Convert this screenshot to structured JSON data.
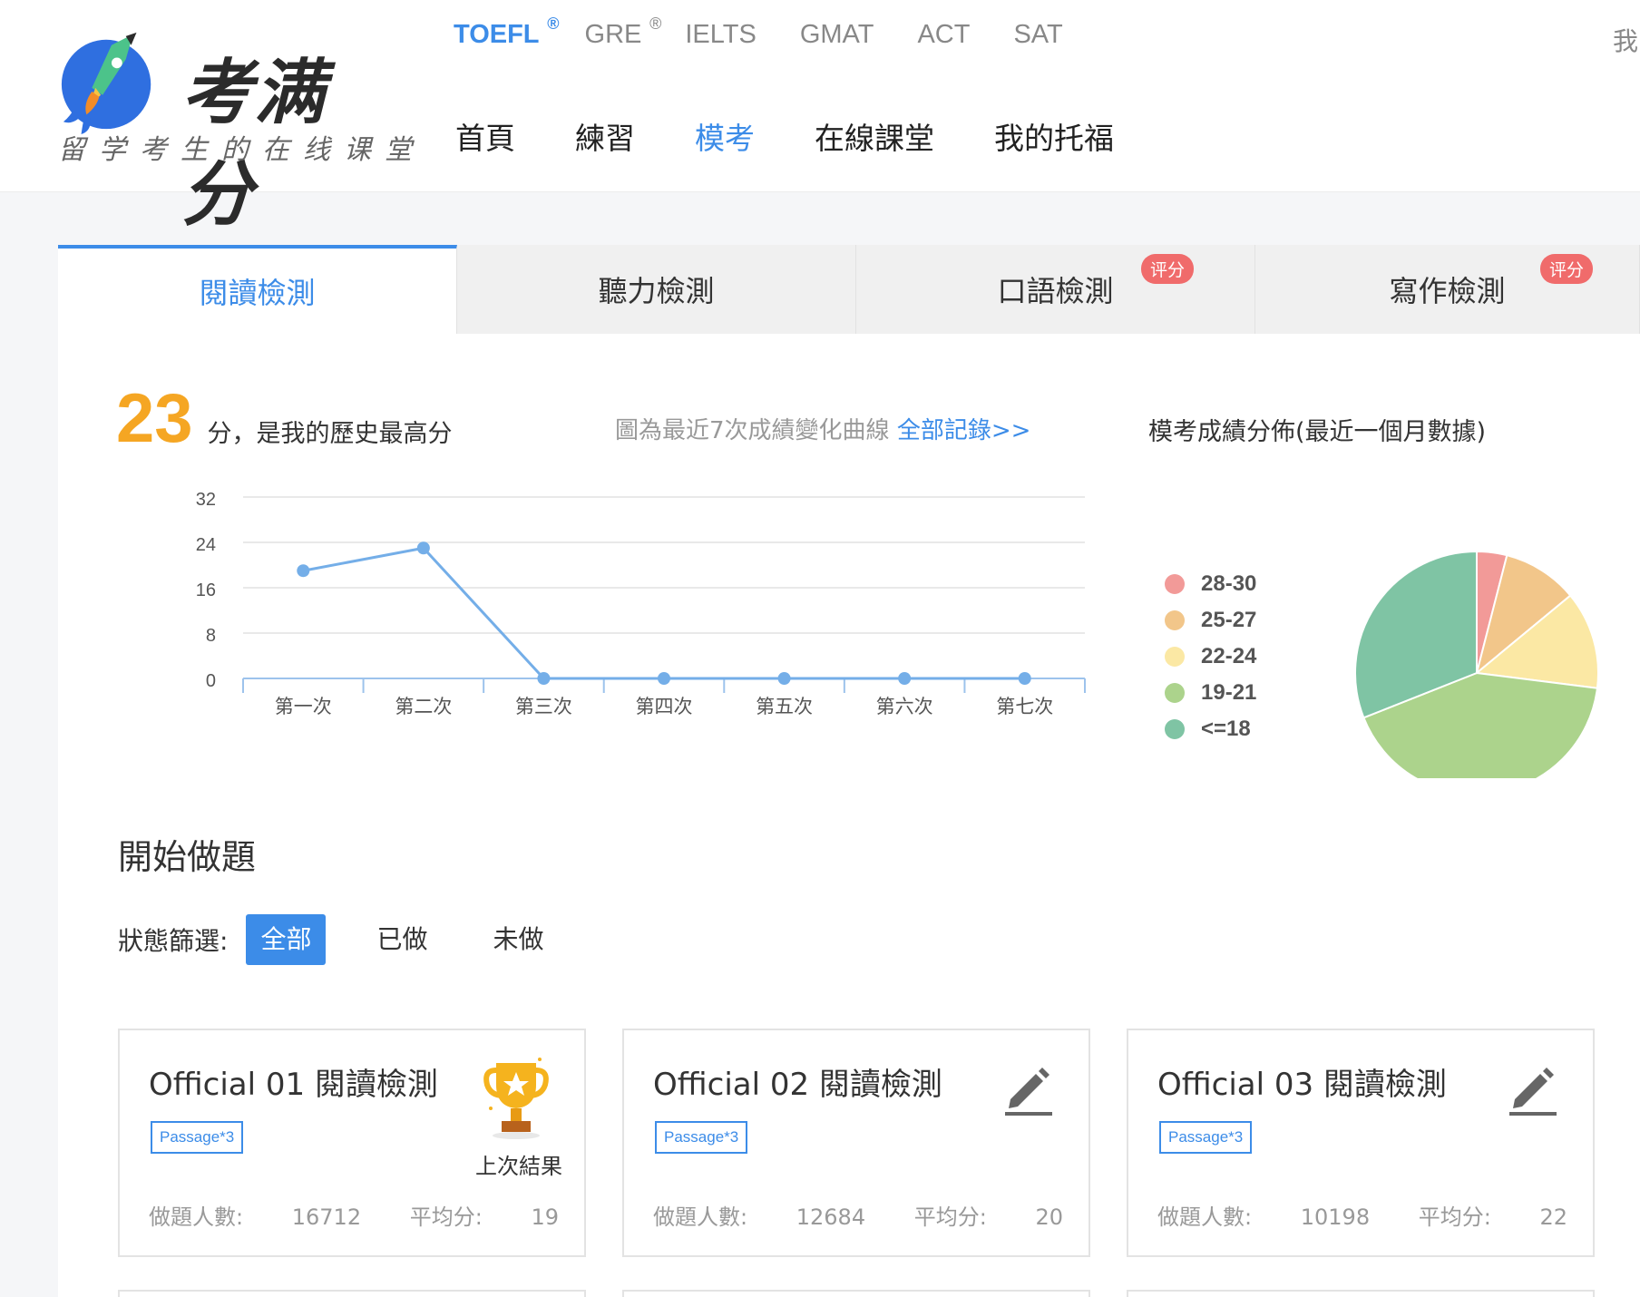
{
  "header": {
    "logo_title": "考满分",
    "logo_subtitle": "留学考生的在线课堂",
    "exam_tabs": [
      {
        "label": "TOEFL",
        "reg": "®"
      },
      {
        "label": "GRE",
        "reg": "®"
      },
      {
        "label": "IELTS",
        "reg": ""
      },
      {
        "label": "GMAT",
        "reg": ""
      },
      {
        "label": "ACT",
        "reg": ""
      },
      {
        "label": "SAT",
        "reg": ""
      }
    ],
    "nav": [
      "首頁",
      "練習",
      "模考",
      "在線課堂",
      "我的托福"
    ],
    "right_text": "我"
  },
  "section_tabs": [
    {
      "label": "閱讀檢測",
      "badge": ""
    },
    {
      "label": "聽力檢測",
      "badge": ""
    },
    {
      "label": "口語檢測",
      "badge": "评分"
    },
    {
      "label": "寫作檢測",
      "badge": "评分"
    }
  ],
  "summary": {
    "best_score": "23",
    "best_text": "分，是我的歷史最高分",
    "recent_note": "圖為最近7次成績變化曲線",
    "all_records_link": "全部記錄>>",
    "pie_title": "模考成績分佈(最近一個月數據)"
  },
  "chart_data": [
    {
      "type": "line",
      "categories": [
        "第一次",
        "第二次",
        "第三次",
        "第四次",
        "第五次",
        "第六次",
        "第七次"
      ],
      "values": [
        19,
        23,
        0,
        0,
        0,
        0,
        0
      ],
      "ylim": [
        0,
        32
      ],
      "yticks": [
        0,
        8,
        16,
        24,
        32
      ],
      "color": "#74aee8",
      "grid": true
    },
    {
      "type": "pie",
      "labels": [
        "28-30",
        "25-27",
        "22-24",
        "19-21",
        "<=18"
      ],
      "values": [
        4,
        10,
        13,
        42,
        31
      ],
      "colors": [
        "#f29a98",
        "#f2c68a",
        "#fbe8a4",
        "#acd38c",
        "#7fc4a4"
      ],
      "legend": "left"
    }
  ],
  "practice": {
    "title": "開始做題",
    "filter_label": "狀態篩選:",
    "filters": [
      "全部",
      "已做",
      "未做"
    ],
    "cards": [
      {
        "title": "Official 01 閱讀檢測",
        "tag": "Passage*3",
        "takers_label": "做題人數:",
        "takers": "16712",
        "avg_label": "平均分:",
        "avg": "19",
        "icon": "trophy-icon",
        "icon_label": "上次結果"
      },
      {
        "title": "Official 02 閱讀檢測",
        "tag": "Passage*3",
        "takers_label": "做題人數:",
        "takers": "12684",
        "avg_label": "平均分:",
        "avg": "20",
        "icon": "pencil-icon",
        "icon_label": ""
      },
      {
        "title": "Official 03 閱讀檢測",
        "tag": "Passage*3",
        "takers_label": "做題人數:",
        "takers": "10198",
        "avg_label": "平均分:",
        "avg": "22",
        "icon": "pencil-icon",
        "icon_label": ""
      }
    ]
  }
}
